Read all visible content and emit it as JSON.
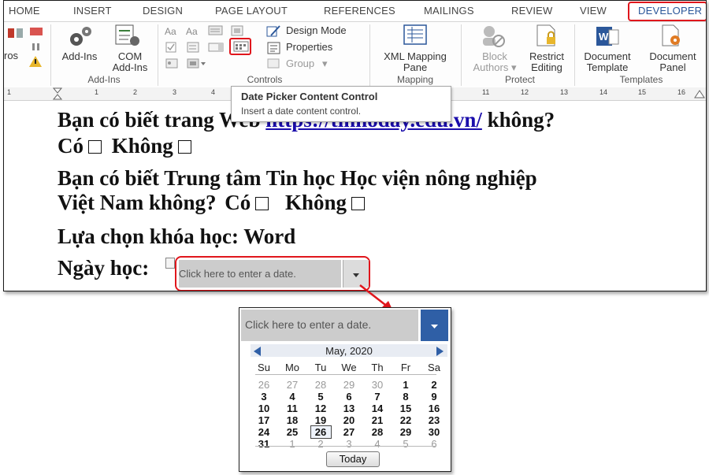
{
  "tabs": [
    "HOME",
    "INSERT",
    "DESIGN",
    "PAGE LAYOUT",
    "REFERENCES",
    "MAILINGS",
    "REVIEW",
    "VIEW",
    "DEVELOPER"
  ],
  "ribbon": {
    "partial_label": "ros",
    "addins": {
      "addins_label": "Add-Ins",
      "com_line1": "COM",
      "com_line2": "Add-Ins",
      "group": "Add-Ins"
    },
    "controls": {
      "design_mode": "Design Mode",
      "properties": "Properties",
      "group_btn": "Group",
      "group": "Controls"
    },
    "mapping": {
      "xml_line1": "XML Mapping",
      "xml_line2": "Pane",
      "group": "Mapping"
    },
    "protect": {
      "block_line1": "Block",
      "block_line2": "Authors",
      "restrict_line1": "Restrict",
      "restrict_line2": "Editing",
      "group": "Protect"
    },
    "templates": {
      "doc_tpl_line1": "Document",
      "doc_tpl_line2": "Template",
      "doc_panel_line1": "Document",
      "doc_panel_line2": "Panel",
      "group": "Templates"
    }
  },
  "ruler": {
    "numbers": [
      "1",
      "1",
      "2",
      "3",
      "4",
      "11",
      "12",
      "13",
      "14",
      "15",
      "16"
    ]
  },
  "tooltip": {
    "title": "Date Picker Content Control",
    "description": "Insert a date content control."
  },
  "document": {
    "q1_prefix": "Bạn có biết trang Web ",
    "q1_link": "https://tinhoday.edu.vn/",
    "q1_suffix": " không?",
    "yes": "Có",
    "no": "Không",
    "q2_line1": "Bạn có biết Trung tâm Tin học Học viện nông nghiệp",
    "q2_line2": "Việt Nam không?",
    "course": "Lựa chọn khóa học: Word",
    "date_label": "Ngày học:",
    "date_placeholder": "Click here to enter a date."
  },
  "popup": {
    "placeholder": "Click here to enter a date.",
    "month": "May, 2020",
    "weekdays": [
      "Su",
      "Mo",
      "Tu",
      "We",
      "Th",
      "Fr",
      "Sa"
    ],
    "weeks": [
      [
        "26",
        "27",
        "28",
        "29",
        "30",
        "1",
        "2"
      ],
      [
        "3",
        "4",
        "5",
        "6",
        "7",
        "8",
        "9"
      ],
      [
        "10",
        "11",
        "12",
        "13",
        "14",
        "15",
        "16"
      ],
      [
        "17",
        "18",
        "19",
        "20",
        "21",
        "22",
        "23"
      ],
      [
        "24",
        "25",
        "26",
        "27",
        "28",
        "29",
        "30"
      ],
      [
        "31",
        "1",
        "2",
        "3",
        "4",
        "5",
        "6"
      ]
    ],
    "selected": "26",
    "today_button": "Today"
  },
  "colors": {
    "accent": "#2b579a",
    "highlight": "#e0161c",
    "link": "#1a0dab",
    "picker_button": "#2f5fa6",
    "field_gray": "#cccccc"
  }
}
